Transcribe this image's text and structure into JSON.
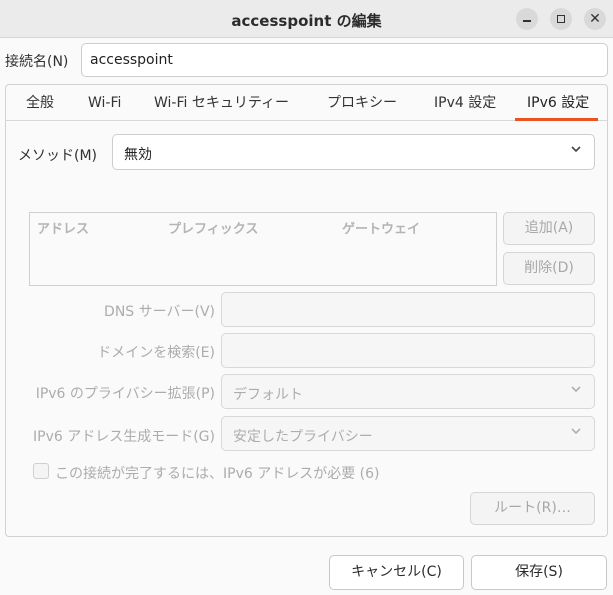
{
  "window": {
    "title": "accesspoint の編集"
  },
  "connection": {
    "label": "接続名(N)",
    "value": "accesspoint"
  },
  "tabs": [
    {
      "label": "全般",
      "active": false
    },
    {
      "label": "Wi-Fi",
      "active": false
    },
    {
      "label": "Wi-Fi セキュリティー",
      "active": false
    },
    {
      "label": "プロキシー",
      "active": false
    },
    {
      "label": "IPv4 設定",
      "active": false
    },
    {
      "label": "IPv6 設定",
      "active": true
    }
  ],
  "ipv6": {
    "method_label": "メソッド(M)",
    "method_value": "無効",
    "address_table": {
      "columns": [
        "アドレス",
        "プレフィックス",
        "ゲートウェイ"
      ]
    },
    "add_button": "追加(A)",
    "delete_button": "削除(D)",
    "dns_label": "DNS サーバー(V)",
    "search_domain_label": "ドメインを検索(E)",
    "privacy_label": "IPv6 のプライバシー拡張(P)",
    "privacy_value": "デフォルト",
    "addr_gen_label": "IPv6 アドレス生成モード(G)",
    "addr_gen_value": "安定したプライバシー",
    "require_checkbox_label": "この接続が完了するには、IPv6 アドレスが必要 (6)",
    "require_checked": false,
    "routes_button": "ルート(R)…"
  },
  "buttons": {
    "cancel": "キャンセル(C)",
    "save": "保存(S)"
  },
  "colors": {
    "accent": "#e95420",
    "disabled_text": "#acacac"
  }
}
